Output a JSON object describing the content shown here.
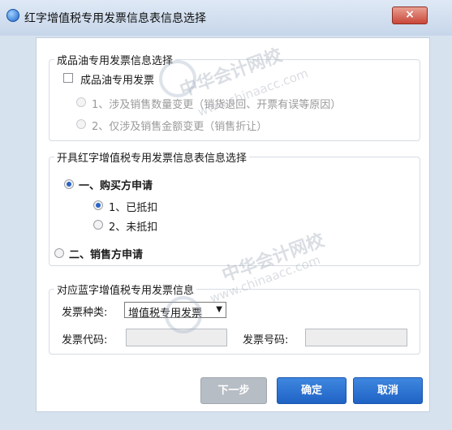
{
  "window": {
    "title": "红字增值税专用发票信息表信息选择",
    "close_glyph": "×"
  },
  "group_oil": {
    "legend": "成品油专用发票信息选择",
    "checkbox_label": "成品油专用发票",
    "checked": false,
    "option1": "1、涉及销售数量变更（销货退回、开票有误等原因）",
    "option2": "2、仅涉及销售金额变更（销售折让）"
  },
  "group_issue": {
    "legend": "开具红字增值税专用发票信息表信息选择",
    "buyer_label": "一、购买方申请",
    "buyer_selected": true,
    "deducted_label": "1、已抵扣",
    "deducted_selected": true,
    "not_deducted_label": "2、未抵扣",
    "seller_label": "二、销售方申请"
  },
  "group_blue": {
    "legend": "对应蓝字增值税专用发票信息",
    "type_label": "发票种类:",
    "type_value": "增值税专用发票",
    "code_label": "发票代码:",
    "code_value": "",
    "number_label": "发票号码:",
    "number_value": ""
  },
  "buttons": {
    "next": "下一步",
    "ok": "确定",
    "cancel": "取消"
  },
  "watermark": {
    "text": "中华会计网校",
    "url": "www.chinaacc.com"
  }
}
